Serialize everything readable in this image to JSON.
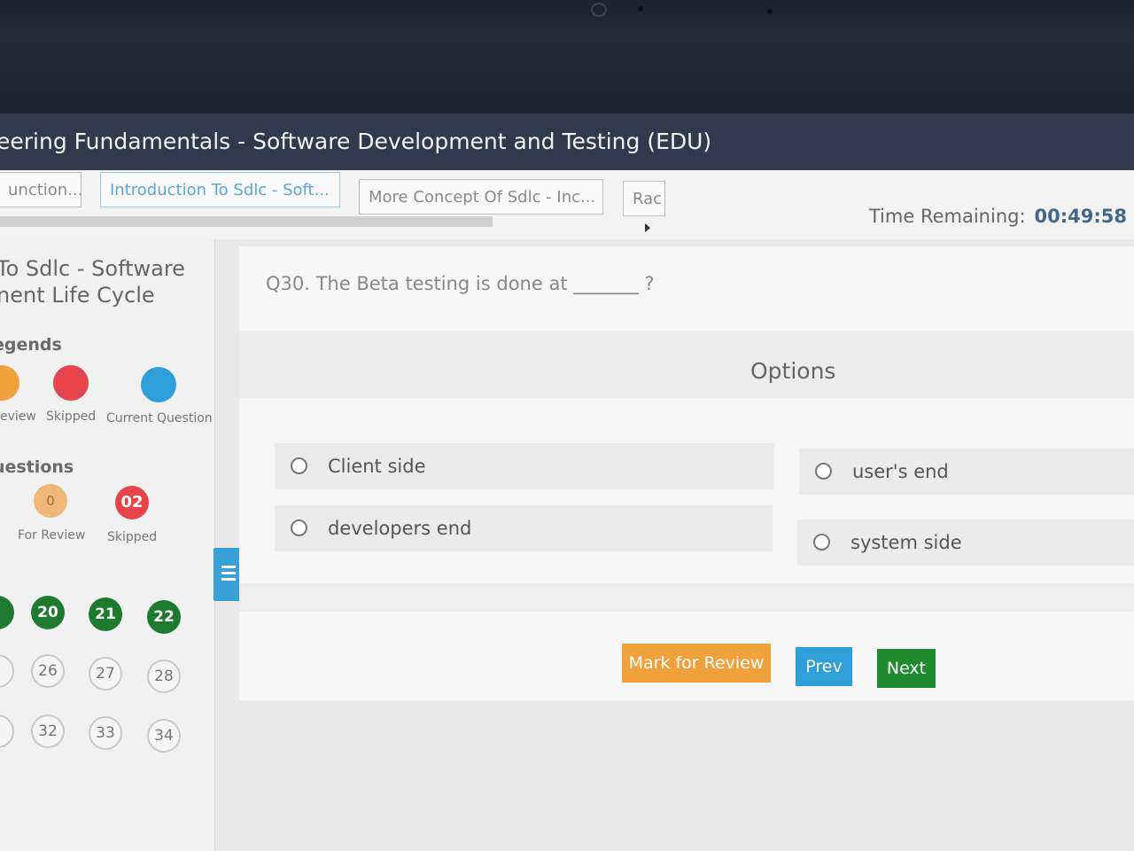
{
  "window": {
    "title": "eering Fundamentals - Software Development and Testing (EDU)"
  },
  "tabs": [
    {
      "label": "unction..."
    },
    {
      "label": "Introduction To Sdlc - Soft...",
      "active": true
    },
    {
      "label": "More Concept Of Sdlc - Inc..."
    },
    {
      "label": "Rac"
    }
  ],
  "timer": {
    "label": "Time Remaining:",
    "value": "00:49:58"
  },
  "sidebar": {
    "title_line1": "To Sdlc - Software",
    "title_line2": "nent Life Cycle",
    "legends_heading": "egends",
    "legends": [
      {
        "label": "eview",
        "color": "#f0a13c"
      },
      {
        "label": "Skipped",
        "color": "#e6434a"
      },
      {
        "label": "Current Question",
        "color": "#2f9fda"
      }
    ],
    "questions_heading": "uestions",
    "counts": [
      {
        "value": "0",
        "label": "For Review",
        "color": "#f0b878"
      },
      {
        "value": "02",
        "label": "Skipped",
        "color": "#e6434a"
      }
    ],
    "question_numbers": [
      "20",
      "21",
      "22",
      "26",
      "27",
      "28",
      "32",
      "33",
      "34"
    ]
  },
  "question": {
    "text": "Q30. The Beta testing is done at _______ ?"
  },
  "options": {
    "heading": "Options",
    "items": [
      {
        "label": "Client side"
      },
      {
        "label": "user's end"
      },
      {
        "label": "developers end"
      },
      {
        "label": "system side"
      }
    ]
  },
  "buttons": {
    "mark_review": "Mark for Review",
    "prev": "Prev",
    "next": "Next"
  }
}
